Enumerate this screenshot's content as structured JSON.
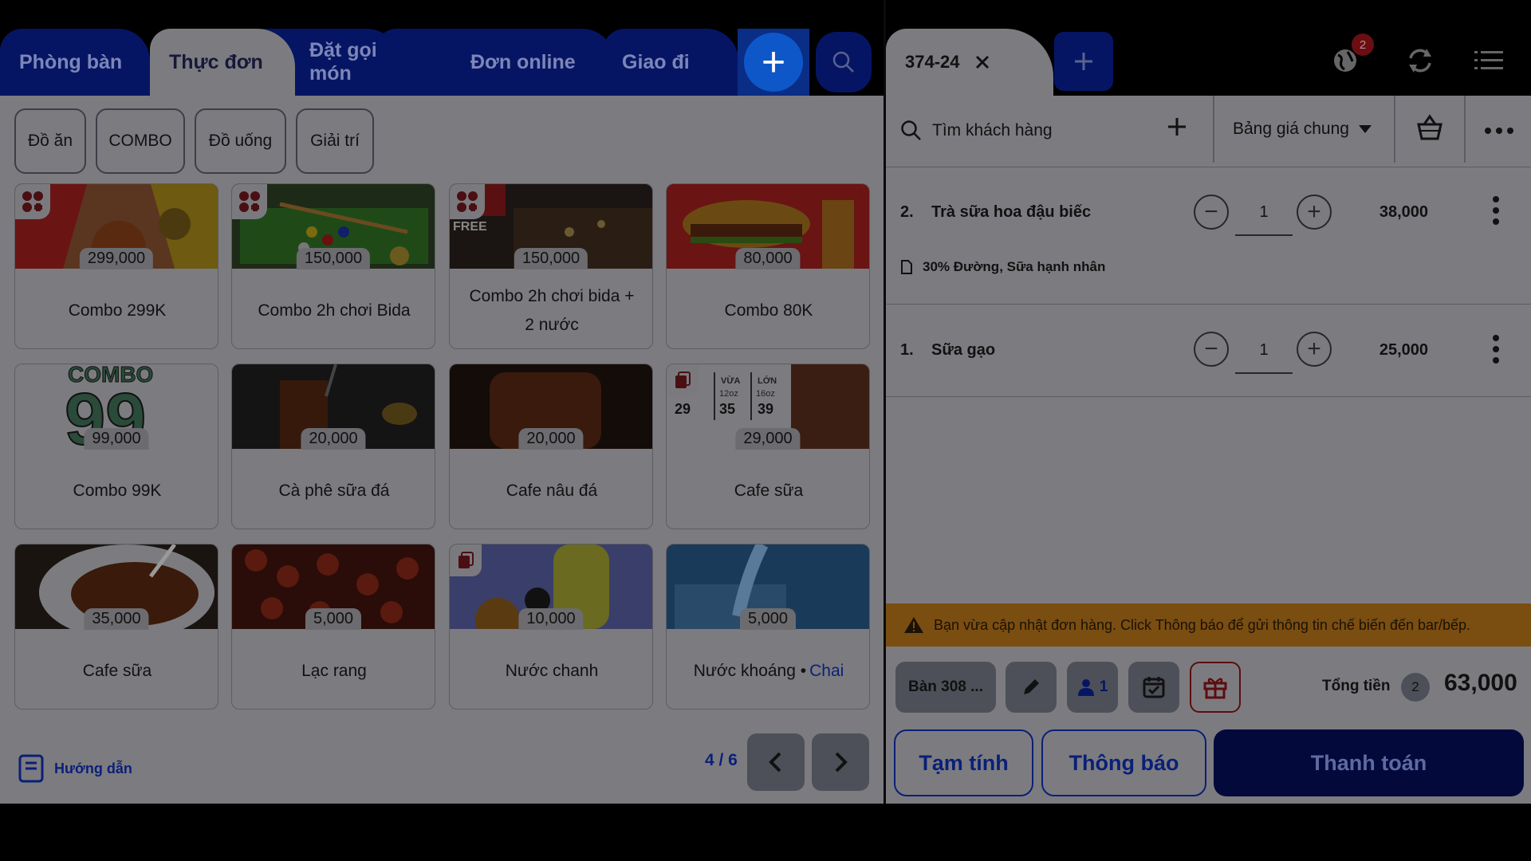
{
  "left_tabs": [
    {
      "label": "Phòng bàn"
    },
    {
      "label": "Thực đơn"
    },
    {
      "label": "Đặt gọi món"
    },
    {
      "label": "Đơn online"
    },
    {
      "label": "Giao đi"
    }
  ],
  "categories": [
    "Đồ ăn",
    "COMBO",
    "Đồ uống",
    "Giải trí"
  ],
  "products": [
    {
      "name": "Combo 299K",
      "price": "299,000"
    },
    {
      "name": "Combo 2h chơi Bida",
      "price": "150,000"
    },
    {
      "name": "Combo 2h chơi bida + 2 nước",
      "price": "150,000"
    },
    {
      "name": "Combo 80K",
      "price": "80,000"
    },
    {
      "name": "Combo 99K",
      "price": "99,000"
    },
    {
      "name": "Cà phê sữa đá",
      "price": "20,000"
    },
    {
      "name": "Cafe nâu đá",
      "price": "20,000"
    },
    {
      "name": "Cafe sữa",
      "price": "29,000"
    },
    {
      "name": "Cafe sữa",
      "price": "35,000"
    },
    {
      "name": "Lạc rang",
      "price": "5,000"
    },
    {
      "name": "Nước chanh",
      "price": "10,000"
    },
    {
      "name": "Nước khoáng",
      "price": "5,000",
      "unit": "Chai"
    }
  ],
  "image_text": {
    "combo99": "COMBO",
    "combo99_num": "99",
    "bida_free": "FREE",
    "cafe_sua_sizes": [
      "",
      "VỪA",
      "LỚN"
    ],
    "cafe_sua_oz": [
      "",
      "12oz",
      "16oz"
    ],
    "cafe_sua_prices": [
      "29",
      "35",
      "39"
    ]
  },
  "guide_label": "Hướng dẫn",
  "pager": "4 / 6",
  "order": {
    "tab_label": "374-24",
    "notification_count": "2",
    "customer_search": "Tìm khách hàng",
    "price_list": "Bảng giá chung",
    "lines": [
      {
        "index": "2.",
        "name": "Trà sữa hoa đậu biếc",
        "qty": "1",
        "amount": "38,000",
        "note": "30% Đường, Sữa hạnh nhân"
      },
      {
        "index": "1.",
        "name": "Sữa gạo",
        "qty": "1",
        "amount": "25,000"
      }
    ],
    "warning": "Bạn vừa cập nhật đơn hàng. Click Thông báo để gửi thông tin chế biến đến bar/bếp.",
    "table": "Bàn 308 ...",
    "guests": "1",
    "total_label": "Tổng tiền",
    "total_count": "2",
    "total_amount": "63,000",
    "btn_provisional": "Tạm tính",
    "btn_notify": "Thông báo",
    "btn_pay": "Thanh toán"
  },
  "colors": {
    "overlay_bg": "#7c7c80",
    "navy": "#061563",
    "accent_blue": "#0d57c9",
    "warning_bg": "#7a4d11",
    "pay_bg": "#03093b"
  }
}
